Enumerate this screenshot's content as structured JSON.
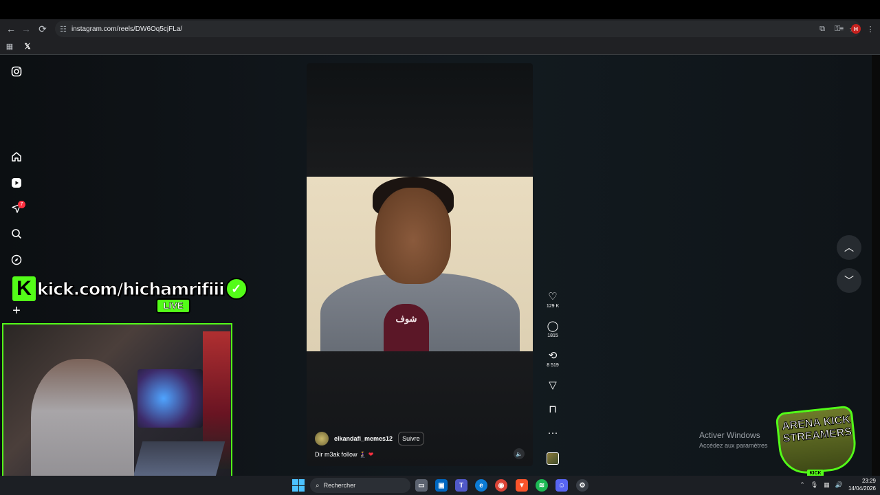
{
  "browser": {
    "url": "instagram.com/reels/DW6Oq5cjFLa/",
    "profile_initial": "H"
  },
  "sidebar": {
    "notifications_badge": "7"
  },
  "reel": {
    "username": "elkandafi_memes12",
    "follow_label": "Suivre",
    "caption": "Dir m3ak follow 🧎‍♀️",
    "caption_heart": "❤",
    "mic_text": "شوف"
  },
  "actions": {
    "likes": "129 K",
    "comments": "1815",
    "reposts": "8 519"
  },
  "overlay": {
    "kick_url": "kick.com/hichamrifiii",
    "live_label": "LIVE",
    "streamer_name": "hichamrifi",
    "arena_line1": "ARENA KICK",
    "arena_line2": "STREAMERS",
    "arena_badge": "KICK"
  },
  "windows": {
    "activate_title": "Activer Windows",
    "activate_sub": "Accédez aux paramètres"
  },
  "taskbar": {
    "search_placeholder": "Rechercher",
    "time": "23:29",
    "date": "14/04/2026"
  },
  "colors": {
    "kick_green": "#53fc18",
    "instagram_red": "#ff3040",
    "windows_blue": "#4cc2ff"
  }
}
